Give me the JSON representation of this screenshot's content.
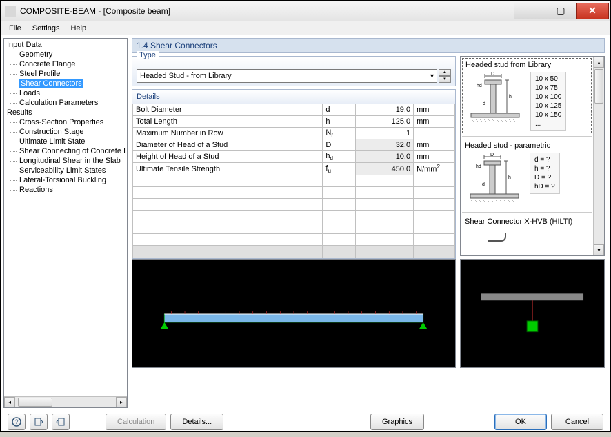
{
  "window": {
    "title": "COMPOSITE-BEAM - [Composite beam]"
  },
  "menu": {
    "file": "File",
    "settings": "Settings",
    "help": "Help"
  },
  "tree": {
    "input": "Input Data",
    "input_items": [
      "Geometry",
      "Concrete Flange",
      "Steel Profile",
      "Shear Connectors",
      "Loads",
      "Calculation Parameters"
    ],
    "results": "Results",
    "results_items": [
      "Cross-Section Properties",
      "Construction Stage",
      "Ultimate Limit State",
      "Shear Connecting of Concrete I",
      "Longitudinal Shear in the Slab",
      "Serviceability Limit States",
      "Lateral-Torsional Buckling",
      "Reactions"
    ]
  },
  "panel_title": "1.4 Shear Connectors",
  "type": {
    "label": "Type",
    "value": "Headed Stud - from Library"
  },
  "details": {
    "label": "Details",
    "rows": [
      {
        "name": "Bolt Diameter",
        "sym_html": "d",
        "val": "19.0",
        "unit": "mm",
        "ro": false
      },
      {
        "name": "Total Length",
        "sym_html": "h",
        "val": "125.0",
        "unit": "mm",
        "ro": false
      },
      {
        "name": "Maximum Number in Row",
        "sym_html": "N<sub>r</sub>",
        "val": "1",
        "unit": "",
        "ro": false
      },
      {
        "name": "Diameter of Head of a Stud",
        "sym_html": "D",
        "val": "32.0",
        "unit": "mm",
        "ro": true
      },
      {
        "name": "Height of Head of a Stud",
        "sym_html": "h<sub>d</sub>",
        "val": "10.0",
        "unit": "mm",
        "ro": true
      },
      {
        "name": "Ultimate Tensile Strength",
        "sym_html": "f<sub>u</sub>",
        "val": "450.0",
        "unit_html": "N/mm<sup>2</sup>",
        "ro": true
      }
    ]
  },
  "library": {
    "item1": {
      "title": "Headed stud from Library",
      "sizes": [
        "10 x 50",
        "10 x 75",
        "10 x 100",
        "10 x 125",
        "10 x 150",
        "..."
      ]
    },
    "item2": {
      "title": "Headed stud - parametric",
      "params": [
        "d   = ?",
        "h   = ?",
        "D   = ?",
        "hD = ?"
      ]
    },
    "item3": {
      "title": "Shear Connector X-HVB (HILTI)"
    }
  },
  "buttons": {
    "calc": "Calculation",
    "details": "Details...",
    "graphics": "Graphics",
    "ok": "OK",
    "cancel": "Cancel"
  }
}
